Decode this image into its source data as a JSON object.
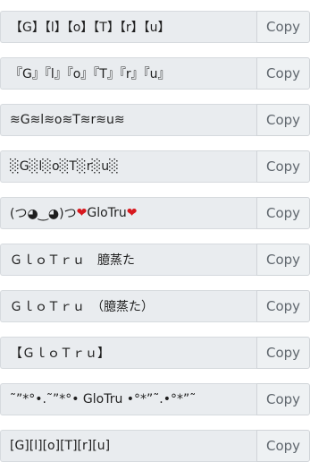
{
  "copy_label": "Copy",
  "rows": [
    {
      "text": "【G】【l】【o】【T】【r】【u】"
    },
    {
      "text": "『G』『l』『o』『T』『r』『u』"
    },
    {
      "text": "≋G≋l≋o≋T≋r≋u≋"
    },
    {
      "text": "░G░l░o░T░r░u░"
    },
    {
      "text": "(つ◕‿◕)つ ❤ GloTru ❤"
    },
    {
      "text": "ＧｌｏＴｒｕ　臆蒸た"
    },
    {
      "text": "ＧｌｏＴｒｕ　（臆蒸た）"
    },
    {
      "text": "【ＧｌｏＴｒｕ】"
    },
    {
      "text": "˜”*°•.˜”*°• GloTru •°*”˜.•°*”˜"
    },
    {
      "text": "[G][l][o][T][r][u]"
    }
  ]
}
